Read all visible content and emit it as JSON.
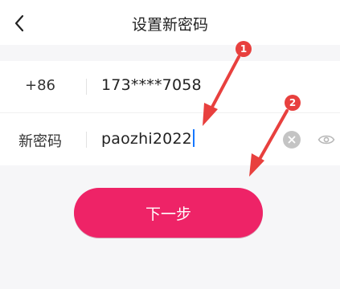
{
  "header": {
    "title": "设置新密码",
    "back_icon": "chevron-left-icon"
  },
  "phone_row": {
    "country_code": "+86",
    "phone": "173****7058"
  },
  "password_row": {
    "label": "新密码",
    "value": "paozhi2022",
    "clear_icon": "clear-icon",
    "visibility_icon": "eye-icon"
  },
  "next_button": {
    "label": "下一步"
  },
  "annotations": {
    "step1": "1",
    "step2": "2"
  },
  "colors": {
    "accent": "#ee2367",
    "annotation": "#e8403e",
    "caret": "#1677ff"
  }
}
